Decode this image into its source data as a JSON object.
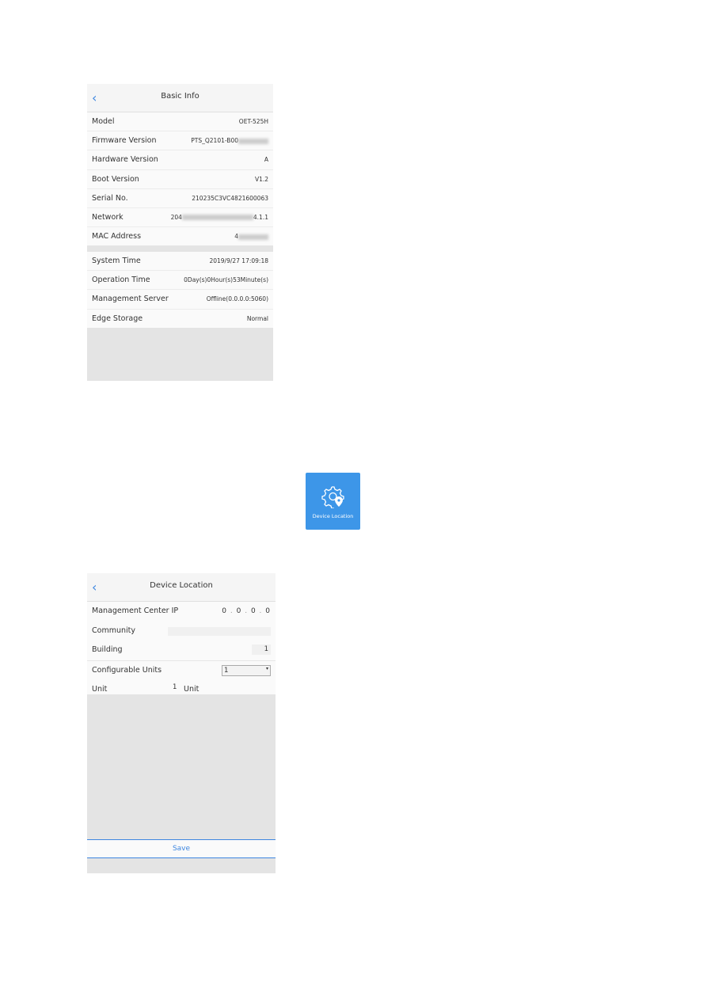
{
  "basic_info": {
    "title": "Basic Info",
    "back_icon": "chevron-left-icon",
    "group1": [
      {
        "label": "Model",
        "value": "OET-525H"
      },
      {
        "label": "Firmware Version",
        "value": "PTS_Q2101-B00",
        "blurred": true
      },
      {
        "label": "Hardware Version",
        "value": "A"
      },
      {
        "label": "Boot Version",
        "value": "V1.2"
      },
      {
        "label": "Serial No.",
        "value": "210235C3VC4821600063"
      },
      {
        "label": "Network",
        "value": "204",
        "value_suffix": "4.1.1",
        "blurred": true
      },
      {
        "label": "MAC Address",
        "value": "4",
        "blurred": true
      }
    ],
    "group2": [
      {
        "label": "System Time",
        "value": "2019/9/27 17:09:18"
      },
      {
        "label": "Operation Time",
        "value": "0Day(s)0Hour(s)53Minute(s)"
      },
      {
        "label": "Management Server",
        "value": "Offline(0.0.0.0:5060)"
      },
      {
        "label": "Edge Storage",
        "value": "Normal"
      }
    ]
  },
  "tile": {
    "label": "Device Location",
    "icon": "gear-location-icon",
    "color": "#3d96e8"
  },
  "device_location": {
    "title": "Device Location",
    "mgmt_ip_label": "Management Center IP",
    "ip": [
      "0",
      "0",
      "0",
      "0"
    ],
    "community_label": "Community",
    "community_value": "",
    "building_label": "Building",
    "building_value": "1",
    "units_label": "Configurable Units",
    "units_value": "1",
    "unit_label": "Unit",
    "unit_value": "1",
    "unit_suffix": "Unit",
    "save_label": "Save"
  },
  "accent": "#3d86e0"
}
